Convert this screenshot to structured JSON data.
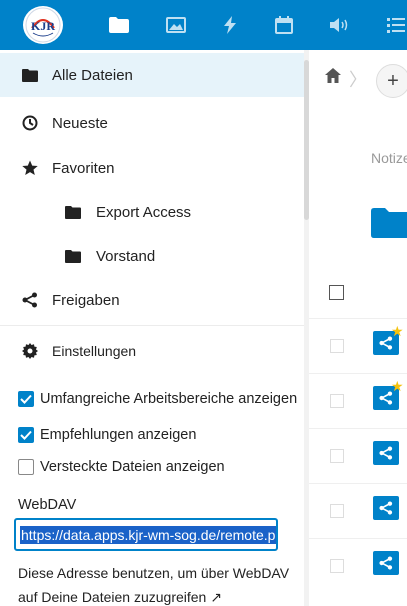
{
  "header": {
    "logo_alt": "KJR",
    "apps": [
      "files-app",
      "photos-app",
      "activity-app",
      "calendar-app",
      "announcements-app",
      "tasks-app"
    ],
    "brand_color": "#0082c9"
  },
  "sidebar": {
    "items": [
      {
        "label": "Alle Dateien",
        "icon": "folder-icon",
        "active": true
      },
      {
        "label": "Neueste",
        "icon": "clock-icon"
      },
      {
        "label": "Favoriten",
        "icon": "star-icon"
      },
      {
        "label": "Export Access",
        "icon": "folder-icon",
        "sub": true
      },
      {
        "label": "Vorstand",
        "icon": "folder-icon",
        "sub": true
      },
      {
        "label": "Freigaben",
        "icon": "share-icon"
      }
    ],
    "settings_label": "Einstellungen",
    "options": [
      {
        "label": "Umfangreiche Arbeitsbereiche anzeigen",
        "checked": true
      },
      {
        "label": "Empfehlungen anzeigen",
        "checked": true
      },
      {
        "label": "Versteckte Dateien anzeigen",
        "checked": false
      }
    ],
    "webdav": {
      "title": "WebDAV",
      "url": "https://data.apps.kjr-wm-sog.de/remote.ph",
      "hint": "Diese Adresse benutzen, um über WebDAV auf Deine Dateien zuzugreifen ↗"
    }
  },
  "main": {
    "notes_label": "Notize",
    "add_label": "+",
    "rows": [
      {
        "type": "shared-folder",
        "favorite": true
      },
      {
        "type": "shared-folder",
        "favorite": true
      },
      {
        "type": "shared-folder",
        "favorite": false
      },
      {
        "type": "shared-folder",
        "favorite": false
      },
      {
        "type": "shared-folder",
        "favorite": false
      }
    ]
  }
}
